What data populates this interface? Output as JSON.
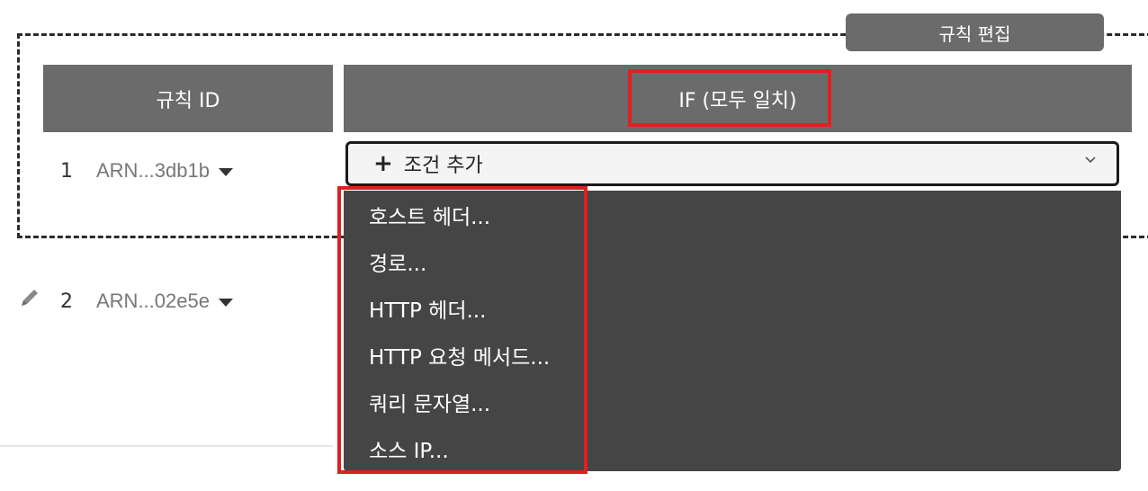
{
  "edit_button": {
    "label": "규칙 편집"
  },
  "table": {
    "headers": {
      "rule_id": "규칙 ID",
      "if": "IF (모두 일치)"
    },
    "rows": [
      {
        "num": "1",
        "arn": "ARN...3db1b"
      },
      {
        "num": "2",
        "arn": "ARN...02e5e"
      }
    ]
  },
  "add_condition": {
    "label": "조건 추가"
  },
  "dropdown": {
    "items": [
      "호스트 헤더...",
      "경로...",
      "HTTP 헤더...",
      "HTTP 요청 메서드...",
      "쿼리 문자열...",
      "소스 IP..."
    ]
  },
  "colors": {
    "header_bg": "#6b6b6b",
    "menu_bg": "#454545",
    "highlight": "#e02020"
  }
}
